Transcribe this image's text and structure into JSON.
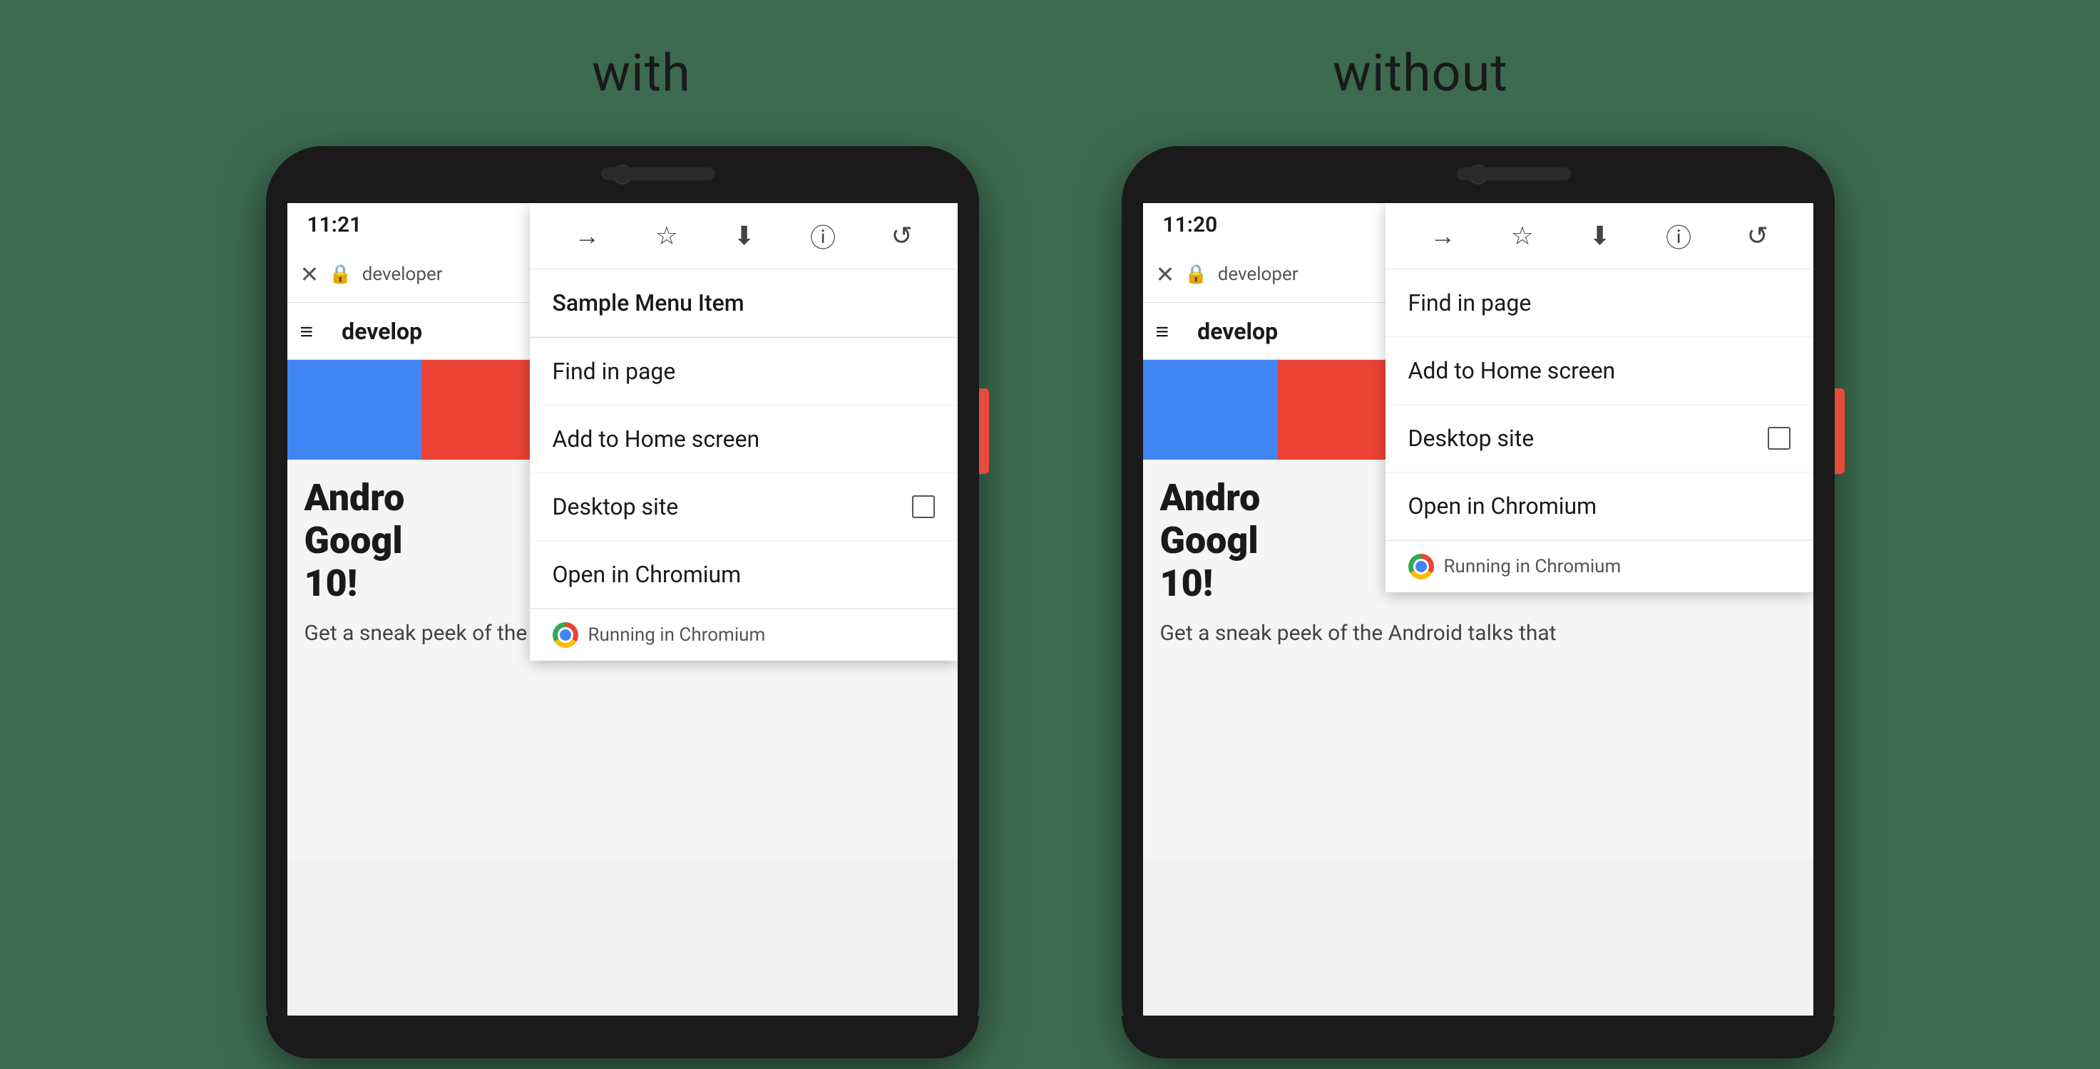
{
  "background": "#3d6b4f",
  "labels": {
    "left": "with",
    "right": "without"
  },
  "phone_left": {
    "time": "11:21",
    "url": "developer",
    "site_name": "develop",
    "menu_items": [
      {
        "label": "Sample Menu Item",
        "has_separator": true
      },
      {
        "label": "Find in page",
        "has_separator": false
      },
      {
        "label": "Add to Home screen",
        "has_separator": false
      },
      {
        "label": "Desktop site",
        "has_checkbox": true,
        "has_separator": false
      },
      {
        "label": "Open in Chromium",
        "has_separator": false
      }
    ],
    "running_label": "Running in Chromium",
    "toolbar_icons": [
      "→",
      "☆",
      "⬇",
      "ⓘ",
      "↺"
    ],
    "web_headline": "Andro\nGoogl\n10!",
    "web_subtext": "Get a sneak peek of the Android talks that"
  },
  "phone_right": {
    "time": "11:20",
    "url": "developer",
    "site_name": "develop",
    "menu_items": [
      {
        "label": "Find in page",
        "has_separator": false
      },
      {
        "label": "Add to Home screen",
        "has_separator": false
      },
      {
        "label": "Desktop site",
        "has_checkbox": true,
        "has_separator": false
      },
      {
        "label": "Open in Chromium",
        "has_separator": false
      }
    ],
    "running_label": "Running in Chromium",
    "toolbar_icons": [
      "→",
      "☆",
      "⬇",
      "ⓘ",
      "↺"
    ],
    "web_headline": "Andro\nGoogl\n10!",
    "web_subtext": "Get a sneak peek of the Android talks that"
  },
  "color_segments": [
    "#4285f4",
    "#ea4335",
    "#34a853",
    "#fbbc05",
    "#1a1a1a"
  ]
}
